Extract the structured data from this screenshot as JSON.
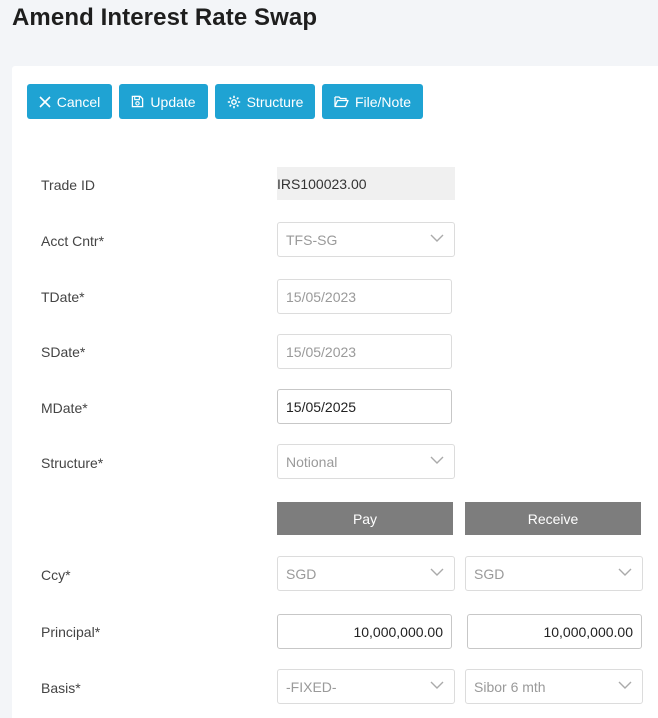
{
  "page": {
    "title": "Amend Interest Rate Swap"
  },
  "toolbar": {
    "cancel": "Cancel",
    "update": "Update",
    "structure": "Structure",
    "file_note": "File/Note",
    "accent": "#1fa3d3"
  },
  "form": {
    "trade_id": {
      "label": "Trade ID",
      "value": "IRS100023.00"
    },
    "acct_cntr": {
      "label": "Acct Cntr*",
      "value": "TFS-SG"
    },
    "tdate": {
      "label": "TDate*",
      "value": "15/05/2023"
    },
    "sdate": {
      "label": "SDate*",
      "value": "15/05/2023"
    },
    "mdate": {
      "label": "MDate*",
      "value": "15/05/2025"
    },
    "structure": {
      "label": "Structure*",
      "value": "Notional"
    },
    "legs": {
      "pay": "Pay",
      "receive": "Receive"
    },
    "ccy": {
      "label": "Ccy*",
      "pay": "SGD",
      "receive": "SGD"
    },
    "principal": {
      "label": "Principal*",
      "pay": "10,000,000.00",
      "receive": "10,000,000.00"
    },
    "basis": {
      "label": "Basis*",
      "pay": "-FIXED-",
      "receive": "Sibor 6 mth"
    }
  }
}
